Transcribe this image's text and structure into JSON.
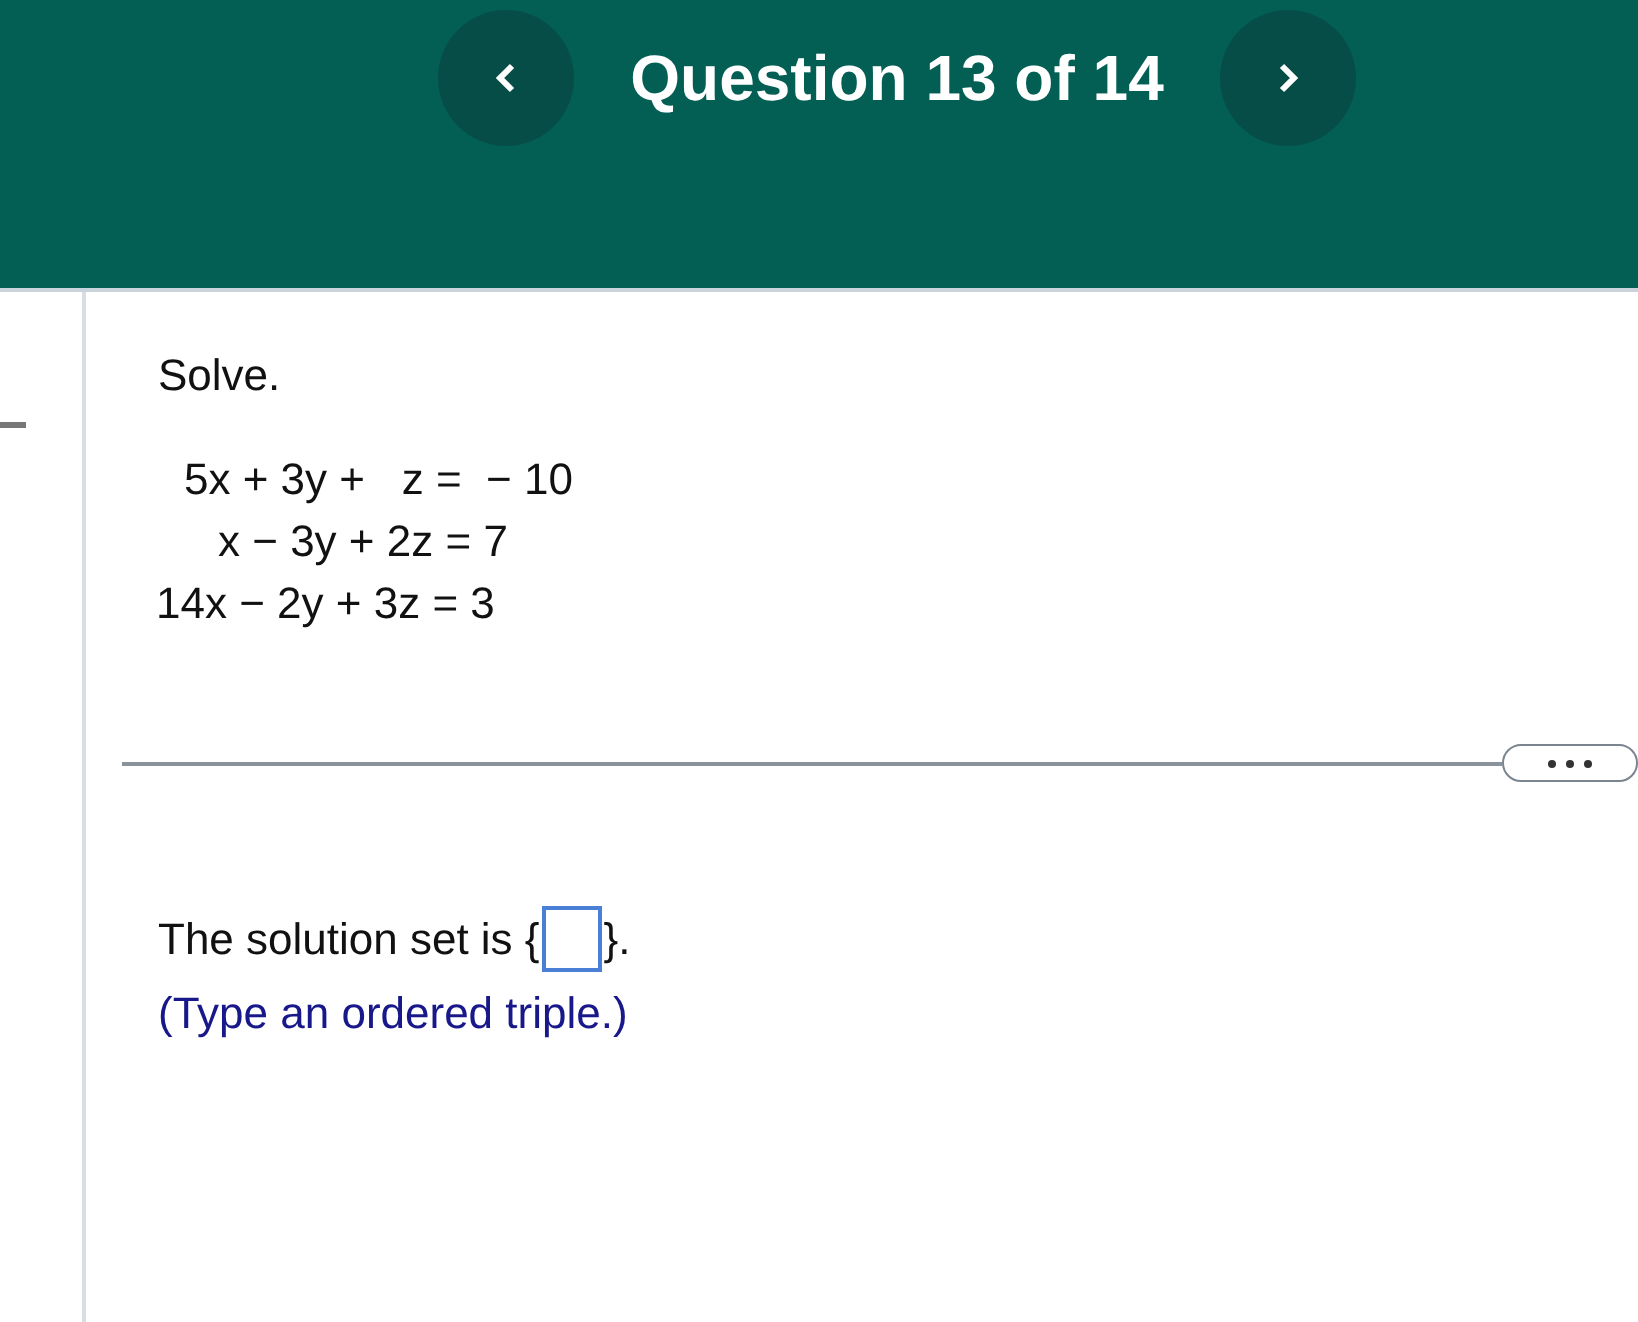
{
  "header": {
    "title": "Question 13 of 14"
  },
  "question": {
    "prompt": "Solve.",
    "equations": [
      "5x + 3y +   z =  − 10",
      "x − 3y + 2z = 7",
      "14x − 2y + 3z = 3"
    ]
  },
  "answer": {
    "before": "The solution set is {",
    "after": "}.",
    "hint": "(Type an ordered triple.)"
  }
}
